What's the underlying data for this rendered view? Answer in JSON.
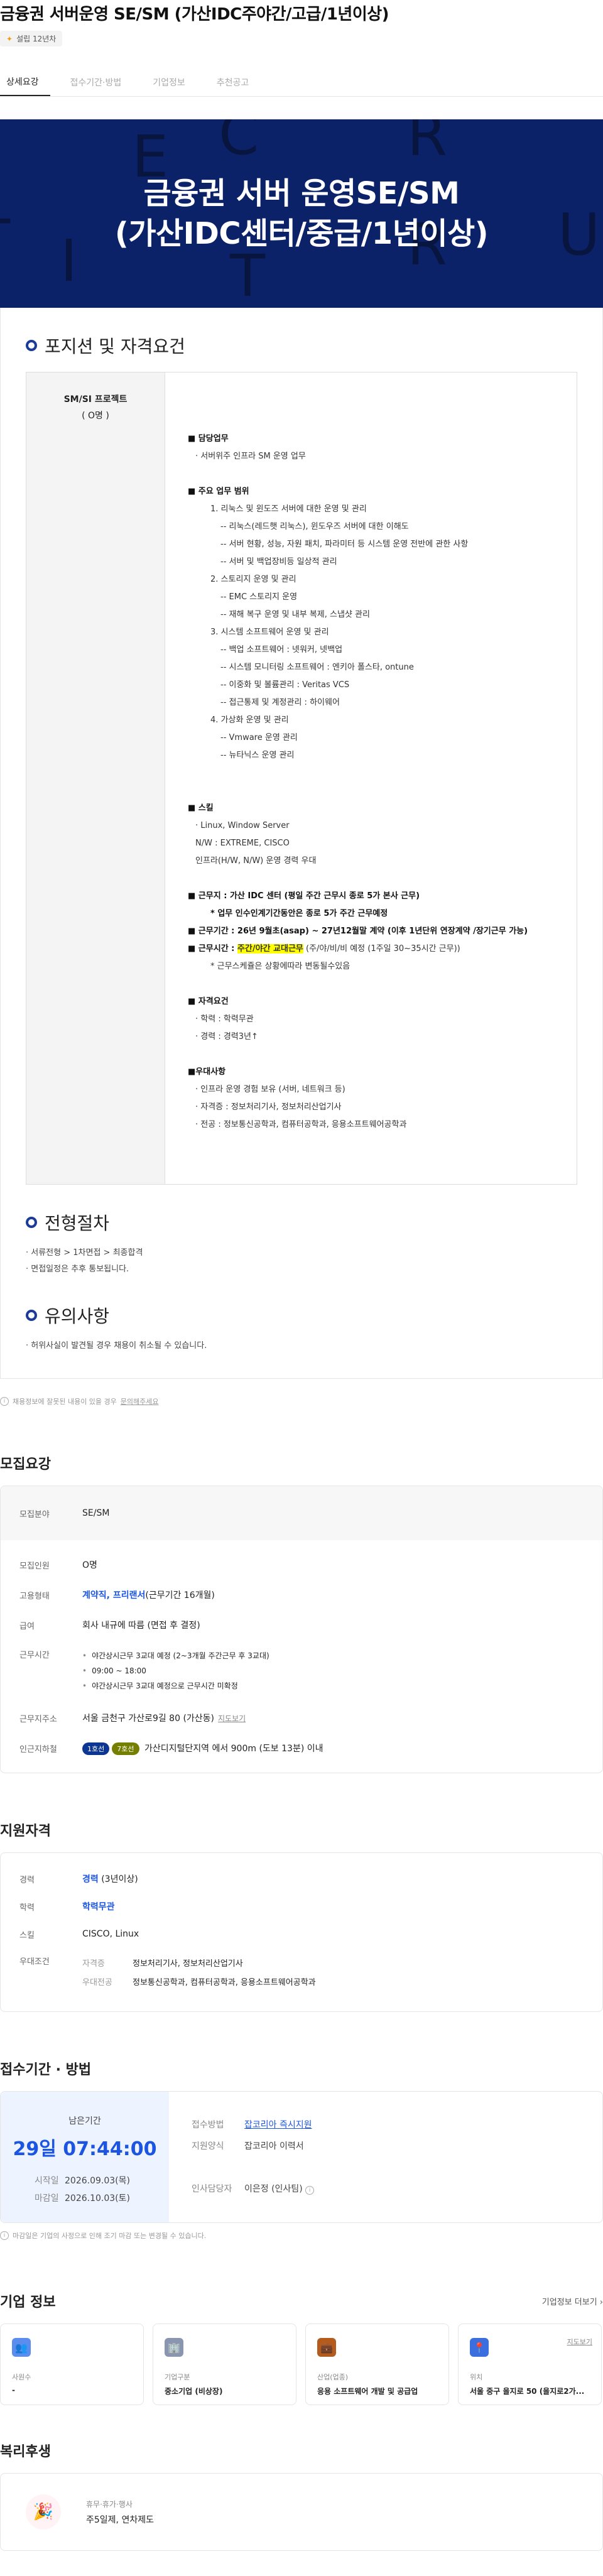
{
  "header": {
    "title": "금융권 서버운영 SE/SM (가산IDC주야간/고급/1년이상)",
    "badge": "설립 12년차"
  },
  "tabs": [
    "상세요강",
    "접수기간·방법",
    "기업정보",
    "추천공고"
  ],
  "poster": {
    "line1": "금융권 서버 운영SE/SM",
    "line2": "(가산IDC센터/중급/1년이상)",
    "bg_letters": [
      "E",
      "C",
      "R",
      "U",
      "I",
      "T",
      "R",
      "T"
    ]
  },
  "position": {
    "heading": "포지션 및 자격요건",
    "left_title": "SM/SI 프로젝트",
    "left_count": "( O명 )",
    "lines": [
      {
        "t": "■ 담당업무",
        "b": true
      },
      {
        "t": "· 서버위주 인프라 SM 운영 업무",
        "i": 1
      },
      {
        "t": "",
        "gap": true
      },
      {
        "t": "■ 주요 업무 범위",
        "b": true
      },
      {
        "t": "1. 리눅스 및 윈도즈 서버에 대한 운영 및 관리",
        "i": 2
      },
      {
        "t": "-- 리눅스(레드햇 리눅스), 윈도우즈 서버에 대한 이해도",
        "i": 3
      },
      {
        "t": "-- 서버 현황, 성능, 자원 패치, 파라미터 등 시스템 운영 전반에 관한 사항",
        "i": 3
      },
      {
        "t": "-- 서버 및 백업장비등 일상적 관리",
        "i": 3
      },
      {
        "t": "2. 스토리지 운영 및 관리",
        "i": 2
      },
      {
        "t": "-- EMC 스토리지 운영",
        "i": 3
      },
      {
        "t": "-- 재해 복구 운영 및 내부 복제, 스냅샷 관리",
        "i": 3
      },
      {
        "t": "3. 시스템 소프트웨어 운영 및 관리",
        "i": 2
      },
      {
        "t": "-- 백업 소프트웨어 : 넷워커, 넷백업",
        "i": 3
      },
      {
        "t": "-- 시스템 모니터링 소프트웨어 : 엔키아 폴스타, ontune",
        "i": 3
      },
      {
        "t": "-- 이중화 및 볼륨관리 : Veritas VCS",
        "i": 3
      },
      {
        "t": "-- 접근통제 및 계정관리 : 하이웨어",
        "i": 3
      },
      {
        "t": "4. 가상화 운영 및 관리",
        "i": 2
      },
      {
        "t": "-- Vmware 운영 관리",
        "i": 3
      },
      {
        "t": "-- 뉴타닉스 운영 관리",
        "i": 3
      },
      {
        "t": "",
        "gap": true
      },
      {
        "t": "",
        "gap": true
      },
      {
        "t": "■ 스킬",
        "b": true
      },
      {
        "t": "· Linux, Window Server",
        "i": 1
      },
      {
        "t": "N/W : EXTREME, CISCO",
        "i": 1
      },
      {
        "t": "인프라(H/W, N/W) 운영 경력 우대",
        "i": 1
      },
      {
        "t": "",
        "gap": true
      },
      {
        "t": "■ 근무지 : 가산 IDC 센터 (평일 주간 근무시 종로 5가 본사 근무)",
        "b": true
      },
      {
        "t": "*  업무 인수인계기간동안은  종로 5가 주간  근무예정",
        "b": true,
        "i": 2
      },
      {
        "t": "■ 근무기간 : 26년 9월초(asap) ~ 27년12월말 계약 (이후 1년단위 연장계약 /장기근무 가능)",
        "b": true
      },
      {
        "t": "■ 근무시간 : ",
        "b": true,
        "hl": "주간/야간 교대근무",
        "tail": " (주/야/비/비 예정 (1주일  30~35시간 근무))"
      },
      {
        "t": "* 근무스케쥴은 상황에따라 변동될수있음",
        "i": 2
      },
      {
        "t": "",
        "gap": true
      },
      {
        "t": "■ 자격요건",
        "b": true
      },
      {
        "t": "· 학력 : 학력무관",
        "i": 1
      },
      {
        "t": "· 경력 : 경력3년↑",
        "i": 1
      },
      {
        "t": "",
        "gap": true
      },
      {
        "t": "■우대사항",
        "b": true
      },
      {
        "t": "· 인프라 운영 경험 보유 (서버, 네트워크 등)",
        "i": 1
      },
      {
        "t": "· 자격증 : 정보처리기사, 정보처리산업기사",
        "i": 1
      },
      {
        "t": "· 전공 : 정보통신공학과, 컴퓨터공학과, 응용소프트웨어공학과",
        "i": 1
      }
    ]
  },
  "process": {
    "heading": "전형절차",
    "items": [
      "· 서류전형 > 1차면접 > 최종합격",
      "· 면접일정은 추후 통보됩니다."
    ]
  },
  "caution": {
    "heading": "유의사항",
    "items": [
      "· 허위사실이 발견될 경우 채용이 취소될 수 있습니다."
    ]
  },
  "notice": {
    "text": "채용정보에 잘못된 내용이 있을 경우 ",
    "link": "문의해주세요"
  },
  "recruit": {
    "heading": "모집요강",
    "field_k": "모집분야",
    "field_v": "SE/SM",
    "count_k": "모집인원",
    "count_v": "O명",
    "emp_k": "고용형태",
    "emp_v": "계약직, 프리랜서",
    "emp_tail": "(근무기간 16개월)",
    "pay_k": "급여",
    "pay_v": "회사 내규에 따름 (면접 후 결정)",
    "time_k": "근무시간",
    "time_items": [
      "야간상시근무 3교대 예정 (2~3개월 주간근무 후 3교대)",
      "09:00 ~ 18:00",
      "야간상시근무 3교대 예정으로 근무시간 미확정"
    ],
    "addr_k": "근무지주소",
    "addr_v": "서울 금천구 가산로9길 80 (가산동)",
    "map_label": "지도보기",
    "station_k": "인근지하철",
    "line7": "7호선",
    "line1": "1호선",
    "station_v": "가산디지털단지역 에서 900m (도보 13분) 이내",
    "line7_color": "#747f00",
    "line1_color": "#0d3692"
  },
  "qualification": {
    "heading": "지원자격",
    "career_k": "경력",
    "career_v": "경력",
    "career_tail": " (3년이상)",
    "edu_k": "학력",
    "edu_v": "학력무관",
    "skill_k": "스킬",
    "skill_v": "CISCO, Linux",
    "pref_k": "우대조건",
    "cert_k": "자격증",
    "cert_v": "정보처리기사, 정보처리산업기사",
    "major_k": "우대전공",
    "major_v": "정보통신공학과, 컴퓨터공학과, 응용소프트웨어공학과"
  },
  "apply": {
    "heading": "접수기간 · 방법",
    "remain_label": "남은기간",
    "remain_value": "29일 07:44:00",
    "start_k": "시작일",
    "start_v": "2026.09.03(목)",
    "end_k": "마감일",
    "end_v": "2026.10.03(토)",
    "method_k": "접수방법",
    "method_v": "잡코리아 즉시지원",
    "form_k": "지원양식",
    "form_v": "잡코리아 이력서",
    "hr_k": "인사담당자",
    "hr_v": "이은정 (인사팀)",
    "footnote": "마감일은 기업의 사정으로 인해 조기 마감 또는 변경될 수 있습니다."
  },
  "company": {
    "heading": "기업 정보",
    "more": "기업정보 더보기",
    "cards": [
      {
        "label": "사원수",
        "value": "-",
        "color": "#5b8def",
        "icon": "people-icon",
        "glyph": "👥"
      },
      {
        "label": "기업구분",
        "value": "중소기업 (비상장)",
        "color": "#8a96b0",
        "icon": "building-icon",
        "glyph": "🏢"
      },
      {
        "label": "산업(업종)",
        "value": "응용 소프트웨어 개발 및 공급업",
        "color": "#b35c1e",
        "icon": "briefcase-icon",
        "glyph": "💼"
      },
      {
        "label": "위치",
        "value": "서울 중구 을지로 50 (을지로2가...",
        "color": "#3b6fe0",
        "icon": "location-icon",
        "glyph": "📍",
        "map": "지도보기"
      }
    ]
  },
  "welfare": {
    "heading": "복리후생",
    "title": "휴무·휴가·행사",
    "value": "주5일제, 연차제도"
  }
}
